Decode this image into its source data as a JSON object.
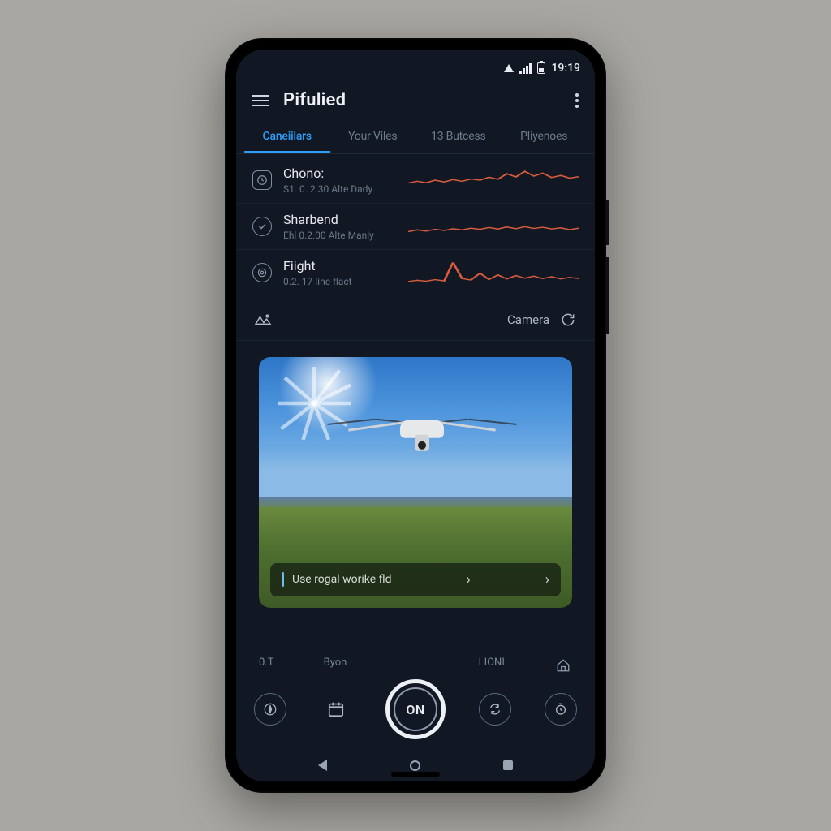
{
  "statusbar": {
    "time": "19:19"
  },
  "appbar": {
    "title": "Pifulied"
  },
  "tabs": [
    {
      "label": "Caneiilars",
      "active": true
    },
    {
      "label": "Your Viles",
      "active": false
    },
    {
      "label": "13 Butcess",
      "active": false
    },
    {
      "label": "Pliyenoes",
      "active": false
    }
  ],
  "list": [
    {
      "name": "Chono:",
      "sub": "S1. 0. 2.30 Alte Dady"
    },
    {
      "name": "Sharbend",
      "sub": "Ehl 0.2.00 Alte Manly"
    },
    {
      "name": "Fiight",
      "sub": "0.2. 17 line flact"
    }
  ],
  "midbar": {
    "camera": "Camera"
  },
  "banner": {
    "text": "Use rogal worike fld"
  },
  "controls": {
    "top": {
      "left": "0.T",
      "mid": "Byon",
      "right": "LIONI"
    },
    "main": "ON"
  },
  "chart_data": [
    {
      "type": "line",
      "title": "",
      "xlabel": "",
      "ylabel": "",
      "ylim": [
        0,
        10
      ],
      "x": [
        0,
        1,
        2,
        3,
        4,
        5,
        6,
        7,
        8,
        9,
        10,
        11,
        12,
        13,
        14,
        15,
        16,
        17,
        18,
        19
      ],
      "values": [
        4,
        4.6,
        4.1,
        5,
        4.4,
        5.2,
        4.6,
        5.4,
        5,
        6,
        5.3,
        7.2,
        6.1,
        8,
        6.4,
        7.4,
        5.9,
        6.6,
        5.7,
        6.2
      ]
    },
    {
      "type": "line",
      "title": "",
      "xlabel": "",
      "ylabel": "",
      "ylim": [
        0,
        10
      ],
      "x": [
        0,
        1,
        2,
        3,
        4,
        5,
        6,
        7,
        8,
        9,
        10,
        11,
        12,
        13,
        14,
        15,
        16,
        17,
        18,
        19
      ],
      "values": [
        3.2,
        3.8,
        3.4,
        4,
        3.6,
        4.2,
        3.8,
        4.4,
        4,
        4.6,
        4.1,
        4.8,
        4.2,
        4.9,
        4.3,
        4.7,
        4.1,
        4.5,
        3.9,
        4.4
      ]
    },
    {
      "type": "line",
      "title": "",
      "xlabel": "",
      "ylabel": "",
      "ylim": [
        0,
        10
      ],
      "x": [
        0,
        1,
        2,
        3,
        4,
        5,
        6,
        7,
        8,
        9,
        10,
        11,
        12,
        13,
        14,
        15,
        16,
        17,
        18,
        19
      ],
      "values": [
        2,
        2.4,
        2.1,
        2.6,
        2.2,
        8.5,
        3,
        2.5,
        4.8,
        2.7,
        4.2,
        2.9,
        4,
        3.1,
        3.8,
        3,
        3.6,
        2.9,
        3.4,
        3
      ]
    }
  ]
}
